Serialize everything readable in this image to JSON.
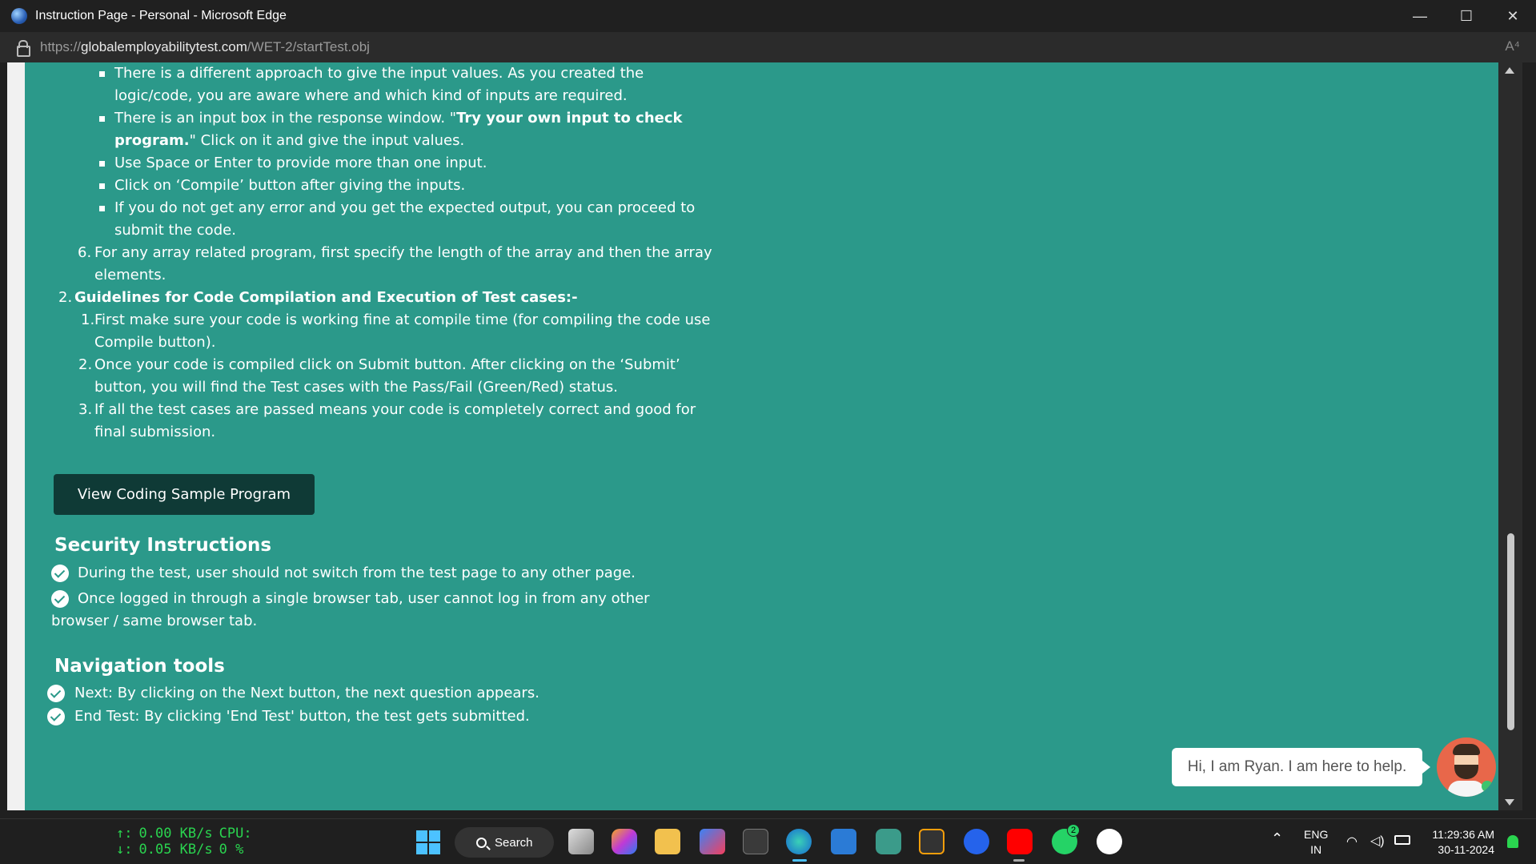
{
  "window": {
    "title": "Instruction Page - Personal - Microsoft Edge",
    "controls": {
      "minimize": "—",
      "maximize": "☐",
      "close": "✕"
    }
  },
  "address": {
    "scheme": "https://",
    "host": "globalemployabilitytest.com",
    "path": "/WET-2/startTest.obj",
    "read_aloud": "A⁴"
  },
  "content": {
    "bullets": {
      "b1_l1": "There is a different approach to give the input values. As you created the",
      "b1_l2": "logic/code, you are aware where and which kind of inputs are required.",
      "b2_l1_pre": "There is an input box in the response window. \"",
      "b2_l1_bold": "Try your own input to check",
      "b2_l2_bold": "program.",
      "b2_l2_post": "\" Click on it and give the input values.",
      "b3": "Use Space or Enter to provide more than one input.",
      "b4": "Click on ‘Compile’ button after giving the inputs.",
      "b5_l1": "If you do not get any error and you get the expected output, you can proceed to",
      "b5_l2": "submit the code."
    },
    "item6": {
      "num": "6.",
      "l1": "For any array related program, first specify the length of the array and then the array",
      "l2": "elements."
    },
    "section2": {
      "num": "2.",
      "title": "Guidelines for Code Compilation and Execution of Test cases:-",
      "items": [
        {
          "num": "1.",
          "l1": "First make sure your code is working fine at compile time (for compiling the code use",
          "l2": "Compile button)."
        },
        {
          "num": "2.",
          "l1": "Once your code is compiled click on Submit button. After clicking on the ‘Submit’",
          "l2": "button, you will find the Test cases with the Pass/Fail (Green/Red) status."
        },
        {
          "num": "3.",
          "l1": "If all the test cases are passed means your code is completely correct and good for",
          "l2": "final submission."
        }
      ]
    },
    "sample_button": "View Coding Sample Program",
    "security": {
      "heading": "Security Instructions",
      "i1": "During the test, user should not switch from the test page to any other page.",
      "i2_l1": "Once logged in through a single browser tab, user cannot log in from any other",
      "i2_l2": "browser / same browser tab."
    },
    "navigation": {
      "heading": "Navigation tools",
      "i1": "Next: By clicking on the Next button, the next question appears.",
      "i2": "End Test: By clicking 'End Test' button, the test gets submitted."
    }
  },
  "chat": {
    "message": "Hi, I am Ryan. I am here to help."
  },
  "taskbar": {
    "net": {
      "up_arrow": "↑:",
      "down_arrow": "↓:",
      "up": "0.00 KB/s",
      "down": "0.05 KB/s",
      "cpu_label": "CPU:",
      "cpu": "0 %"
    },
    "search": "Search",
    "whatsapp_badge": "2",
    "lang1": "ENG",
    "lang2": "IN",
    "time": "11:29:36 AM",
    "date": "30-11-2024"
  },
  "colors": {
    "page_bg": "#2b998a",
    "button_bg": "#0f3a36",
    "net_green": "#2ad44f"
  }
}
